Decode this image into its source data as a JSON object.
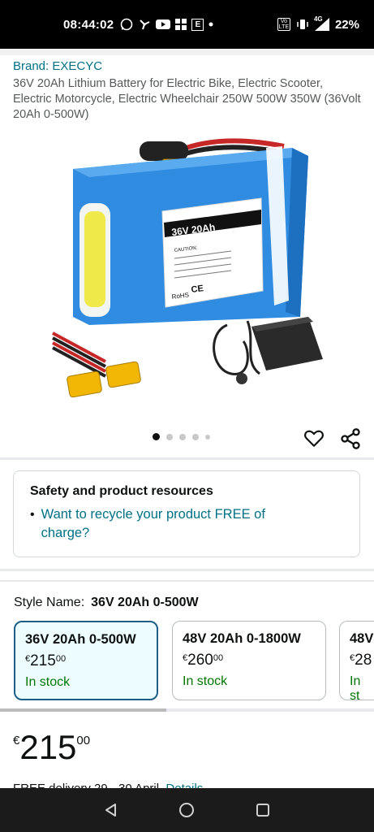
{
  "status_bar": {
    "time": "08:44:02",
    "battery_pct": "22%",
    "network_label": "4G",
    "volte_label": "Vo LTE",
    "news_label": "E"
  },
  "product": {
    "brand": "Brand: EXECYC",
    "title": "36V 20Ah Lithium Battery for Electric Bike, Electric Scooter, Electric Motorcycle, Electric Wheelchair 250W 500W 350W (36Volt 20Ah 0-500W)",
    "label_title": "36V 20Ah",
    "label_caution": "CAUTION:",
    "label_rohs": "RoHS",
    "label_ce": "CE"
  },
  "carousel": {
    "total": 5,
    "active": 0
  },
  "safety": {
    "title": "Safety and product resources",
    "link": "Want to recycle your product FREE of charge?"
  },
  "style": {
    "label": "Style Name:",
    "selected": "36V 20Ah 0-500W",
    "options": [
      {
        "name": "36V 20Ah 0-500W",
        "currency": "€",
        "whole": "215",
        "fraction": "00",
        "stock": "In stock"
      },
      {
        "name": "48V 20Ah 0-1800W",
        "currency": "€",
        "whole": "260",
        "fraction": "00",
        "stock": "In stock"
      },
      {
        "name": "48V",
        "currency": "€",
        "whole": "28",
        "fraction": "",
        "stock": "In st"
      }
    ]
  },
  "price": {
    "currency": "€",
    "whole": "215",
    "fraction": "00"
  },
  "delivery": {
    "text": "FREE delivery 29 - 30 April.",
    "link": "Details"
  },
  "colors": {
    "link": "#007185",
    "stock": "#007600",
    "selected_border": "#1d5e87",
    "selected_bg": "#edfdff"
  }
}
